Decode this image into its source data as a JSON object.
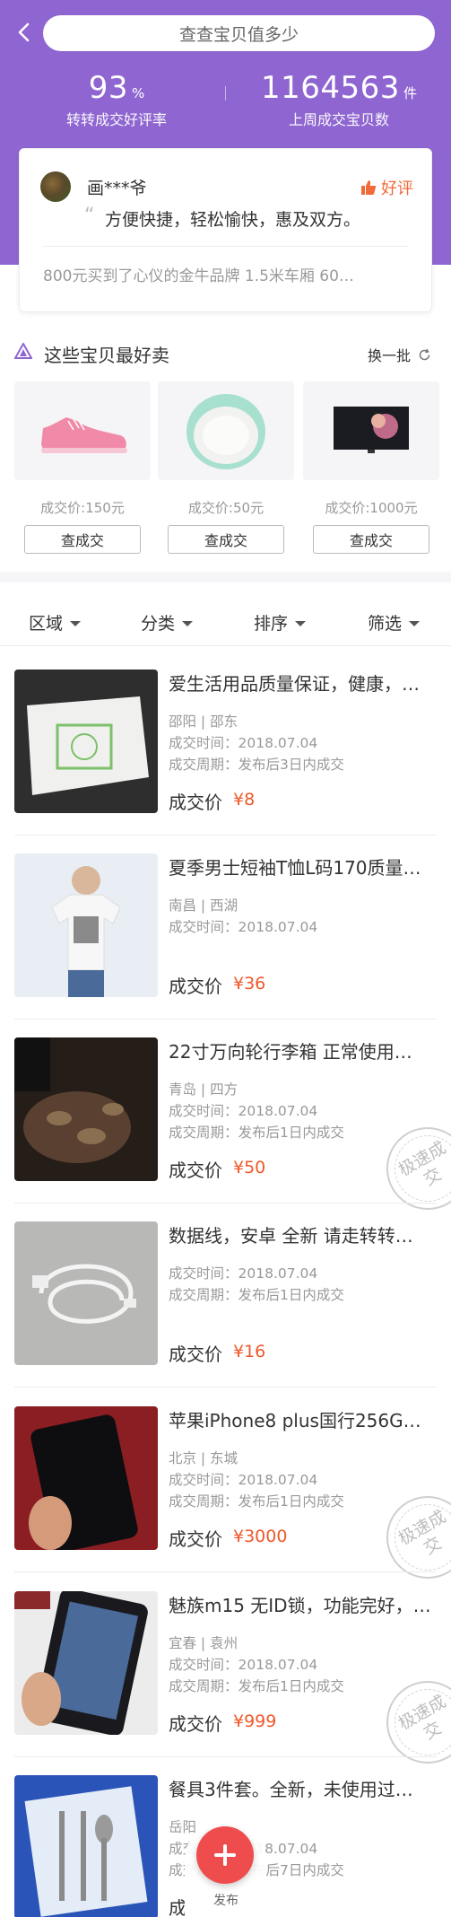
{
  "header": {
    "search_text": "查查宝贝值多少",
    "stats": [
      {
        "value": "93",
        "unit": "%",
        "label": "转转成交好评率"
      },
      {
        "value": "1164563",
        "unit": "件",
        "label": "上周成交宝贝数"
      }
    ]
  },
  "review": {
    "name": "画***爷",
    "badge": "好评",
    "quote": "“",
    "text": "方便快捷，轻松愉快，惠及双方。",
    "description": "800元买到了心仪的金牛品牌 1.5米车厢 60…"
  },
  "hot_section": {
    "title": "这些宝贝最好卖",
    "refresh_label": "换一批",
    "items": [
      {
        "image_icon": "sneaker-icon",
        "price": "成交价:150元",
        "button": "查成交"
      },
      {
        "image_icon": "compact-powder-icon",
        "price": "成交价:50元",
        "button": "查成交"
      },
      {
        "image_icon": "tv-icon",
        "price": "成交价:1000元",
        "button": "查成交"
      }
    ]
  },
  "filters": [
    "区域",
    "分类",
    "排序",
    "筛选"
  ],
  "listings": [
    {
      "title": "爱生活用品质量保证，健康，…",
      "location": "邵阳 | 邵东",
      "time": "成交时间：2018.07.04",
      "cycle": "成交周期：发布后3日内成交",
      "price_label": "成交价",
      "price": "¥8",
      "fast": false,
      "image_icon": "tissue-box-icon"
    },
    {
      "title": "夏季男士短袖T恤L码170质量…",
      "location": "南昌 | 西湖",
      "time": "成交时间：2018.07.04",
      "cycle": "",
      "price_label": "成交价",
      "price": "¥36",
      "fast": false,
      "image_icon": "tshirt-icon"
    },
    {
      "title": "22寸万向轮行李箱 正常使用…",
      "location": "青岛 | 四方",
      "time": "成交时间：2018.07.04",
      "cycle": "成交周期：发布后1日内成交",
      "price_label": "成交价",
      "price": "¥50",
      "fast": true,
      "image_icon": "suitcase-icon"
    },
    {
      "title": "数据线，安卓 全新 请走转转…",
      "location": "",
      "time": "成交时间：2018.07.04",
      "cycle": "成交周期：发布后1日内成交",
      "price_label": "成交价",
      "price": "¥16",
      "fast": false,
      "image_icon": "usb-cable-icon"
    },
    {
      "title": "苹果iPhone8 plus国行256G…",
      "location": "北京 | 东城",
      "time": "成交时间：2018.07.04",
      "cycle": "成交周期：发布后1日内成交",
      "price_label": "成交价",
      "price": "¥3000",
      "fast": true,
      "image_icon": "phone-icon"
    },
    {
      "title": "魅族m15 无ID锁，功能完好，…",
      "location": "宜春 | 袁州",
      "time": "成交时间：2018.07.04",
      "cycle": "成交周期：发布后1日内成交",
      "price_label": "成交价",
      "price": "¥999",
      "fast": true,
      "image_icon": "phone-icon"
    },
    {
      "title": "餐具3件套。全新，未使用过…",
      "location": "岳阳",
      "time": "成交时间：2018.07.04",
      "cycle": "成交周期：发布后7日内成交",
      "price_label": "成",
      "price": "",
      "fast": false,
      "image_icon": "cutlery-set-icon"
    }
  ],
  "fast_stamp": "极速成交",
  "fab": {
    "label": "发布"
  }
}
